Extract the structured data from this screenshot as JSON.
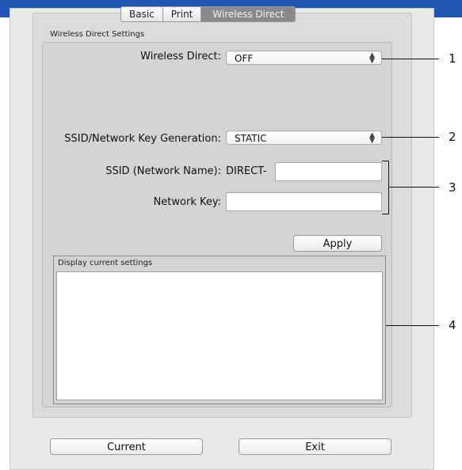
{
  "tabs": [
    "Basic",
    "Print",
    "Wireless Direct"
  ],
  "group_title": "Wireless Direct Settings",
  "wireless_direct": {
    "label": "Wireless Direct:",
    "value": "OFF"
  },
  "ssid_key_generation": {
    "label": "SSID/Network Key Generation:",
    "value": "STATIC"
  },
  "ssid": {
    "label": "SSID (Network Name):",
    "prefix": "DIRECT-",
    "value": ""
  },
  "network_key": {
    "label": "Network Key:",
    "value": ""
  },
  "apply_label": "Apply",
  "display_title": "Display current settings",
  "buttons": {
    "current": "Current",
    "exit": "Exit"
  },
  "callouts": [
    "1",
    "2",
    "3",
    "4"
  ],
  "colors": {
    "header": "#1e56b2",
    "panel": "#e9e9e9"
  }
}
